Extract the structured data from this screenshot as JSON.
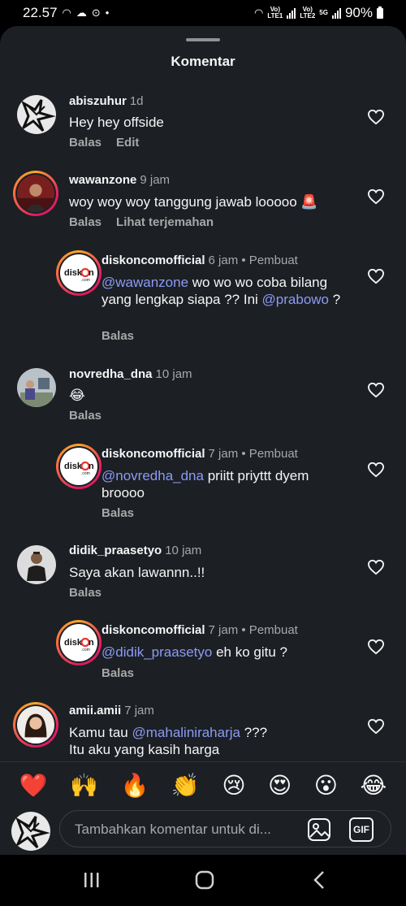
{
  "status_bar": {
    "time": "22.57",
    "signal1_label": "LTE1",
    "signal2_label": "LTE2",
    "network": "5G",
    "volte": "Vo)",
    "battery": "90%"
  },
  "sheet": {
    "title": "Komentar"
  },
  "comments": [
    {
      "user": "abiszuhur",
      "time": "1d",
      "text": "Hey hey offside",
      "actions": [
        "Balas",
        "Edit"
      ]
    },
    {
      "user": "wawanzone",
      "time": "9 jam",
      "text": "woy woy woy tanggung jawab looooo 🚨",
      "actions": [
        "Balas",
        "Lihat terjemahan"
      ]
    },
    {
      "user": "diskoncomofficial",
      "time": "6 jam",
      "author_tag": "• Pembuat",
      "mention1": "@wawanzone",
      "text1": " wo wo wo coba bilang yang lengkap siapa ?? Ini ",
      "mention2": "@prabowo",
      "text2": " ?",
      "actions": [
        "Balas"
      ]
    },
    {
      "user": "novredha_dna",
      "time": "10 jam",
      "text": "😂",
      "actions": [
        "Balas"
      ]
    },
    {
      "user": "diskoncomofficial",
      "time": "7 jam",
      "author_tag": "• Pembuat",
      "mention1": "@novredha_dna",
      "text1": " priitt priyttt dyem broooo",
      "actions": [
        "Balas"
      ]
    },
    {
      "user": "didik_praasetyo",
      "time": "10 jam",
      "text": "Saya akan lawannn..!!",
      "actions": [
        "Balas"
      ]
    },
    {
      "user": "diskoncomofficial",
      "time": "7 jam",
      "author_tag": "• Pembuat",
      "mention1": "@didik_praasetyo",
      "text1": " eh ko gitu ?",
      "actions": [
        "Balas"
      ]
    },
    {
      "user": "amii.amii",
      "time": "7 jam",
      "text_pre": "Kamu tau ",
      "mention1": "@mahaliniraharja",
      "text1": " ???",
      "text_line2": "Itu aku yang kasih harga"
    }
  ],
  "diskon_logo": {
    "text_a": "disk",
    "text_b": "n",
    "text_c": ".com"
  },
  "reactions": [
    "❤️",
    "🙌",
    "🔥",
    "👏",
    "😢",
    "😍",
    "😮",
    "😂"
  ],
  "composer": {
    "placeholder": "Tambahkan komentar untuk di...",
    "gif_label": "GIF"
  },
  "colors": {
    "background": "#1c1f24",
    "mention": "#8b9bf5",
    "secondary": "#a8a8a8",
    "story_ring": "#e91e63"
  }
}
